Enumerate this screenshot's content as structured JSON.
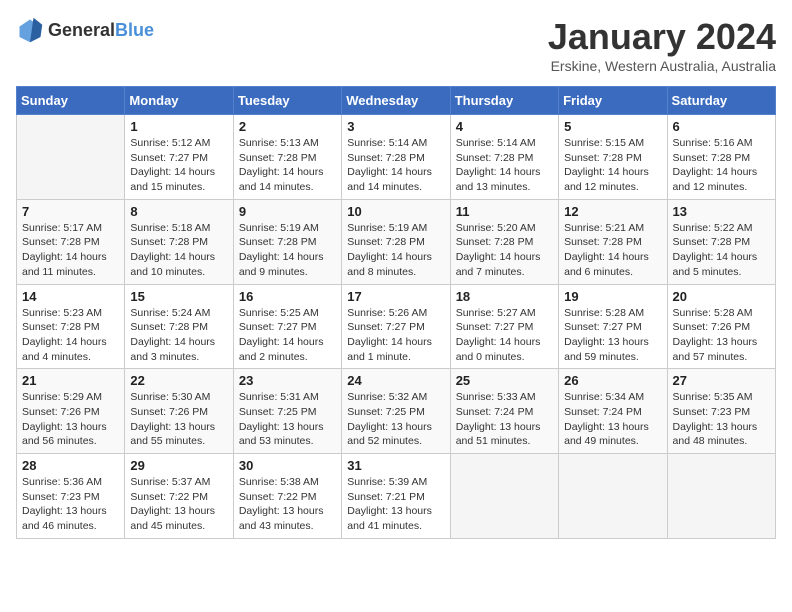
{
  "logo": {
    "general": "General",
    "blue": "Blue"
  },
  "header": {
    "month": "January 2024",
    "location": "Erskine, Western Australia, Australia"
  },
  "weekdays": [
    "Sunday",
    "Monday",
    "Tuesday",
    "Wednesday",
    "Thursday",
    "Friday",
    "Saturday"
  ],
  "weeks": [
    [
      {
        "day": "",
        "info": ""
      },
      {
        "day": "1",
        "info": "Sunrise: 5:12 AM\nSunset: 7:27 PM\nDaylight: 14 hours\nand 15 minutes."
      },
      {
        "day": "2",
        "info": "Sunrise: 5:13 AM\nSunset: 7:28 PM\nDaylight: 14 hours\nand 14 minutes."
      },
      {
        "day": "3",
        "info": "Sunrise: 5:14 AM\nSunset: 7:28 PM\nDaylight: 14 hours\nand 14 minutes."
      },
      {
        "day": "4",
        "info": "Sunrise: 5:14 AM\nSunset: 7:28 PM\nDaylight: 14 hours\nand 13 minutes."
      },
      {
        "day": "5",
        "info": "Sunrise: 5:15 AM\nSunset: 7:28 PM\nDaylight: 14 hours\nand 12 minutes."
      },
      {
        "day": "6",
        "info": "Sunrise: 5:16 AM\nSunset: 7:28 PM\nDaylight: 14 hours\nand 12 minutes."
      }
    ],
    [
      {
        "day": "7",
        "info": "Sunrise: 5:17 AM\nSunset: 7:28 PM\nDaylight: 14 hours\nand 11 minutes."
      },
      {
        "day": "8",
        "info": "Sunrise: 5:18 AM\nSunset: 7:28 PM\nDaylight: 14 hours\nand 10 minutes."
      },
      {
        "day": "9",
        "info": "Sunrise: 5:19 AM\nSunset: 7:28 PM\nDaylight: 14 hours\nand 9 minutes."
      },
      {
        "day": "10",
        "info": "Sunrise: 5:19 AM\nSunset: 7:28 PM\nDaylight: 14 hours\nand 8 minutes."
      },
      {
        "day": "11",
        "info": "Sunrise: 5:20 AM\nSunset: 7:28 PM\nDaylight: 14 hours\nand 7 minutes."
      },
      {
        "day": "12",
        "info": "Sunrise: 5:21 AM\nSunset: 7:28 PM\nDaylight: 14 hours\nand 6 minutes."
      },
      {
        "day": "13",
        "info": "Sunrise: 5:22 AM\nSunset: 7:28 PM\nDaylight: 14 hours\nand 5 minutes."
      }
    ],
    [
      {
        "day": "14",
        "info": "Sunrise: 5:23 AM\nSunset: 7:28 PM\nDaylight: 14 hours\nand 4 minutes."
      },
      {
        "day": "15",
        "info": "Sunrise: 5:24 AM\nSunset: 7:28 PM\nDaylight: 14 hours\nand 3 minutes."
      },
      {
        "day": "16",
        "info": "Sunrise: 5:25 AM\nSunset: 7:27 PM\nDaylight: 14 hours\nand 2 minutes."
      },
      {
        "day": "17",
        "info": "Sunrise: 5:26 AM\nSunset: 7:27 PM\nDaylight: 14 hours\nand 1 minute."
      },
      {
        "day": "18",
        "info": "Sunrise: 5:27 AM\nSunset: 7:27 PM\nDaylight: 14 hours\nand 0 minutes."
      },
      {
        "day": "19",
        "info": "Sunrise: 5:28 AM\nSunset: 7:27 PM\nDaylight: 13 hours\nand 59 minutes."
      },
      {
        "day": "20",
        "info": "Sunrise: 5:28 AM\nSunset: 7:26 PM\nDaylight: 13 hours\nand 57 minutes."
      }
    ],
    [
      {
        "day": "21",
        "info": "Sunrise: 5:29 AM\nSunset: 7:26 PM\nDaylight: 13 hours\nand 56 minutes."
      },
      {
        "day": "22",
        "info": "Sunrise: 5:30 AM\nSunset: 7:26 PM\nDaylight: 13 hours\nand 55 minutes."
      },
      {
        "day": "23",
        "info": "Sunrise: 5:31 AM\nSunset: 7:25 PM\nDaylight: 13 hours\nand 53 minutes."
      },
      {
        "day": "24",
        "info": "Sunrise: 5:32 AM\nSunset: 7:25 PM\nDaylight: 13 hours\nand 52 minutes."
      },
      {
        "day": "25",
        "info": "Sunrise: 5:33 AM\nSunset: 7:24 PM\nDaylight: 13 hours\nand 51 minutes."
      },
      {
        "day": "26",
        "info": "Sunrise: 5:34 AM\nSunset: 7:24 PM\nDaylight: 13 hours\nand 49 minutes."
      },
      {
        "day": "27",
        "info": "Sunrise: 5:35 AM\nSunset: 7:23 PM\nDaylight: 13 hours\nand 48 minutes."
      }
    ],
    [
      {
        "day": "28",
        "info": "Sunrise: 5:36 AM\nSunset: 7:23 PM\nDaylight: 13 hours\nand 46 minutes."
      },
      {
        "day": "29",
        "info": "Sunrise: 5:37 AM\nSunset: 7:22 PM\nDaylight: 13 hours\nand 45 minutes."
      },
      {
        "day": "30",
        "info": "Sunrise: 5:38 AM\nSunset: 7:22 PM\nDaylight: 13 hours\nand 43 minutes."
      },
      {
        "day": "31",
        "info": "Sunrise: 5:39 AM\nSunset: 7:21 PM\nDaylight: 13 hours\nand 41 minutes."
      },
      {
        "day": "",
        "info": ""
      },
      {
        "day": "",
        "info": ""
      },
      {
        "day": "",
        "info": ""
      }
    ]
  ]
}
